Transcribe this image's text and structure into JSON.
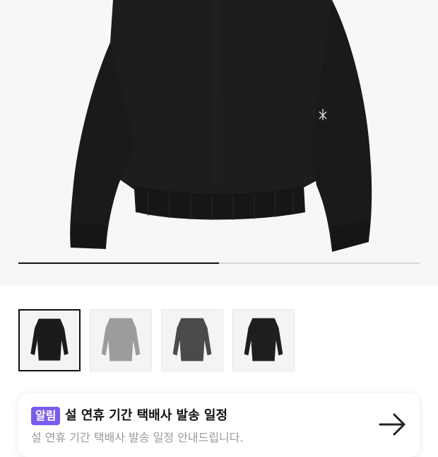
{
  "gallery": {
    "progress_fraction": 0.5,
    "thumbnails": [
      {
        "name": "black-sweater",
        "color": "#1b1b1d",
        "selected": true
      },
      {
        "name": "grey-sweater",
        "color": "#9c9c9c",
        "selected": false
      },
      {
        "name": "charcoal-sweater",
        "color": "#4a4a4c",
        "selected": false
      },
      {
        "name": "black-sweater-alt",
        "color": "#1e1e20",
        "selected": false
      }
    ]
  },
  "notice": {
    "badge": "알림",
    "title": "설 연휴 기간 택배사 발송 일정",
    "subtitle": "설 연휴 기간 택배사 발송 일정 안내드립니다.",
    "arrow_icon": "arrow-right-icon"
  },
  "colors": {
    "badge_bg": "#7b5cf0",
    "hero_bg": "#f7f7f7",
    "sweater_main": "#1c1c1e"
  }
}
